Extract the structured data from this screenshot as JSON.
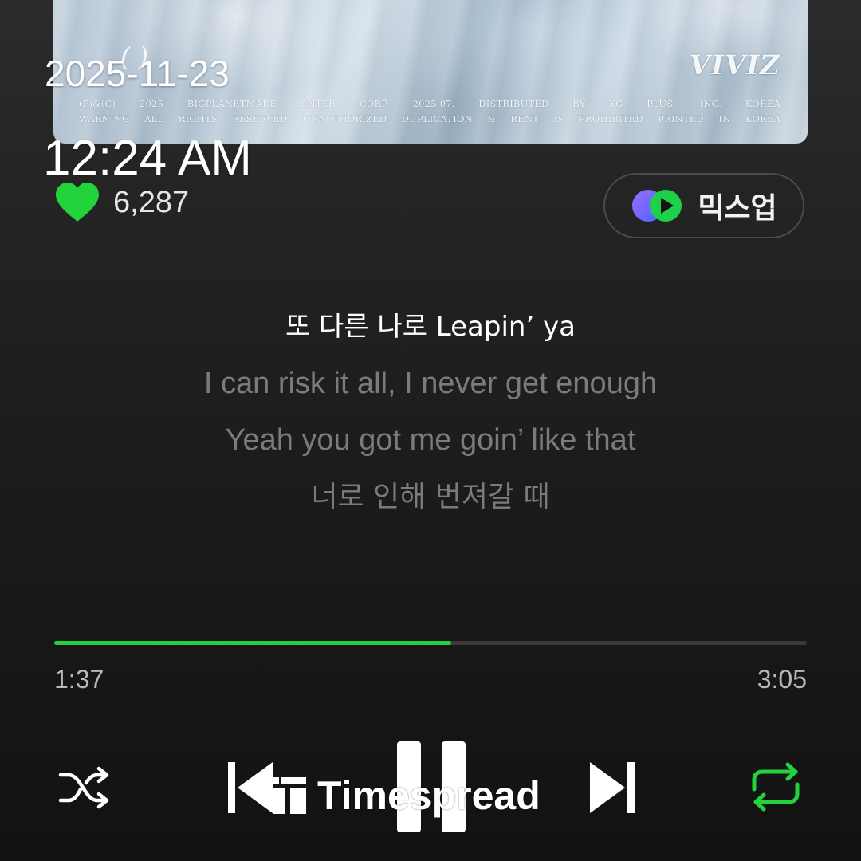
{
  "album": {
    "logo_text": "VIVIZ",
    "script_text": "( )",
    "credits_line1": "(P)&(C) 2025 BIGPLANETMADE ENTER CORP. 2025.07. DISTRIBUTED BY YG PLUS, INC. KOREA",
    "credits_line2": "WARNING ALL RIGHTS RESERVED UNAUTHORIZED DUPLICATION & RENT IS PROHIBITED PRINTED IN KOREA"
  },
  "overlay": {
    "date": "2025-11-23",
    "time": "12:24 AM"
  },
  "like": {
    "icon": "heart-icon",
    "count": "6,287",
    "color": "#22d33c"
  },
  "mixup": {
    "label": "믹스업",
    "icon": "mixup-icon"
  },
  "lyrics": {
    "lines": [
      "또 다른 나로 Leapin’ ya",
      "I can risk it all, I never get enough",
      "Yeah you got me goin’ like that",
      "너로 인해 번져갈 때"
    ],
    "current_index": 0
  },
  "playback": {
    "elapsed": "1:37",
    "total": "3:05",
    "progress": 0.528,
    "accent_color": "#22d33c"
  },
  "controls": {
    "shuffle_icon": "shuffle-icon",
    "prev_icon": "skip-previous-icon",
    "pause_icon": "pause-icon",
    "next_icon": "skip-next-icon",
    "repeat_icon": "repeat-icon",
    "repeat_active": true
  },
  "watermark": {
    "text": "Timespread"
  }
}
